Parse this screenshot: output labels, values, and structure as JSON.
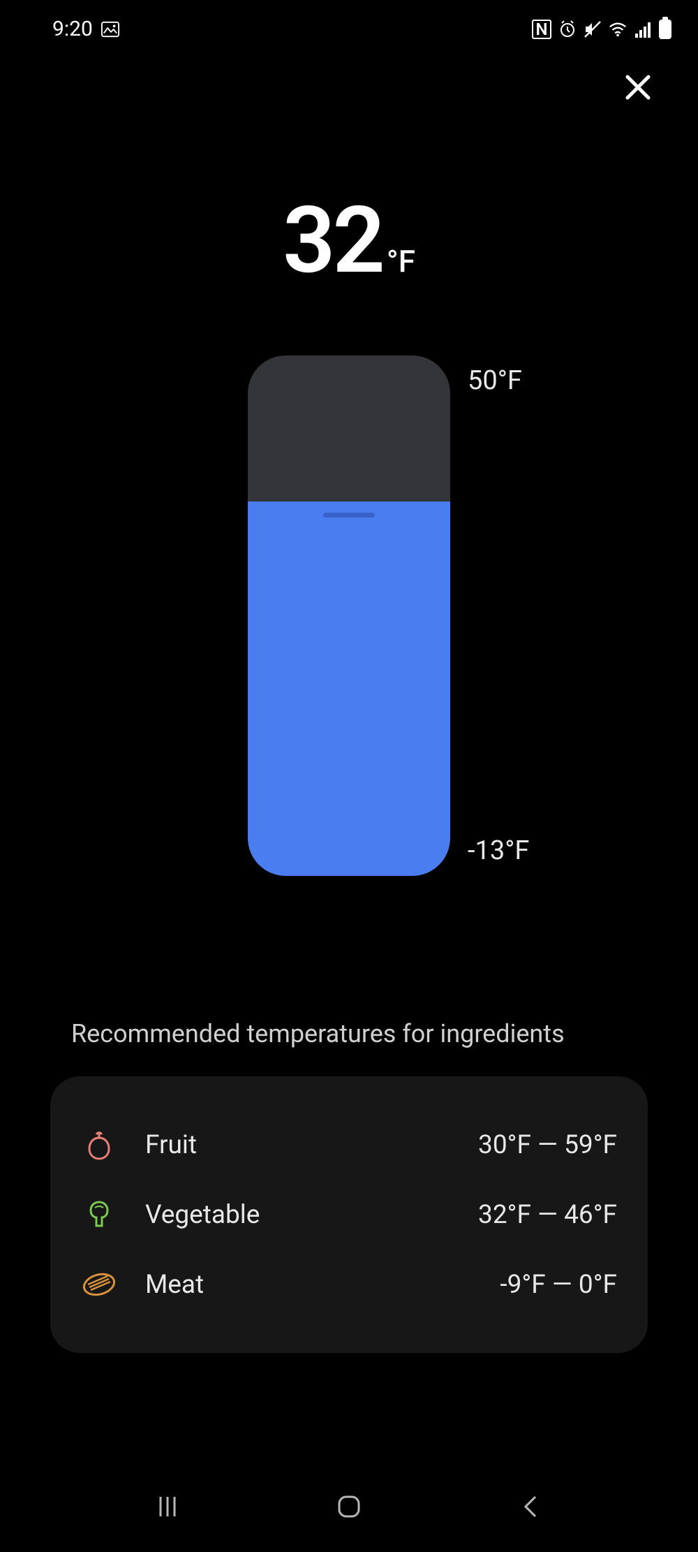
{
  "statusBar": {
    "time": "9:20"
  },
  "temperature": {
    "value": "32",
    "unit": "°F"
  },
  "slider": {
    "maxLabel": "50°F",
    "minLabel": "-13°F",
    "fillPercent": 72
  },
  "recommended": {
    "title": "Recommended temperatures for ingredients",
    "items": [
      {
        "name": "Fruit",
        "range": "30°F — 59°F",
        "iconColor": "#e88178"
      },
      {
        "name": "Vegetable",
        "range": "32°F — 46°F",
        "iconColor": "#7bc950"
      },
      {
        "name": "Meat",
        "range": "-9°F — 0°F",
        "iconColor": "#d8923a"
      }
    ]
  }
}
